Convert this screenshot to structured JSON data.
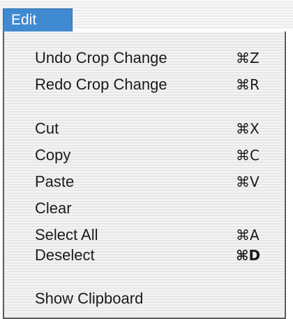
{
  "menubar": {
    "title": "Edit"
  },
  "menu": {
    "items": [
      {
        "label": "Undo Crop Change",
        "shortcut": "⌘Z"
      },
      {
        "label": "Redo Crop Change",
        "shortcut": "⌘R"
      },
      {
        "label": "Cut",
        "shortcut": "⌘X"
      },
      {
        "label": "Copy",
        "shortcut": "⌘C"
      },
      {
        "label": "Paste",
        "shortcut": "⌘V"
      },
      {
        "label": "Clear",
        "shortcut": ""
      },
      {
        "label": "Select All",
        "shortcut": "⌘A"
      },
      {
        "label": "Deselect",
        "shortcut": "⌘D"
      },
      {
        "label": "Show Clipboard",
        "shortcut": ""
      }
    ]
  },
  "colors": {
    "menu_title_bg": "#3f8ad0",
    "menu_title_text": "#ffffff",
    "menu_text": "#1b1b1b",
    "menu_border": "#5a5a5a"
  }
}
